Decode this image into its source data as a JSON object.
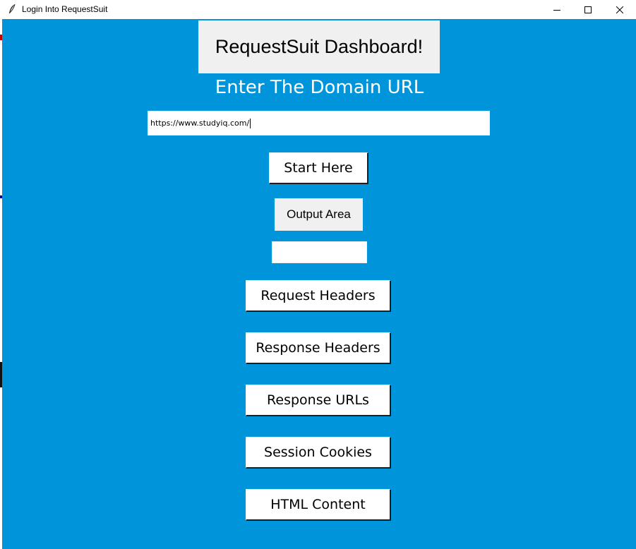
{
  "window": {
    "title": "Login Into RequestSuit",
    "controls": {
      "minimize": "minimize-icon",
      "maximize": "maximize-icon",
      "close": "close-icon"
    }
  },
  "header": {
    "title": "RequestSuit Dashboard!"
  },
  "form": {
    "prompt": "Enter The Domain URL",
    "url_value": "https://www.studyiq.com/",
    "start_label": "Start Here"
  },
  "output": {
    "label": "Output Area",
    "value": ""
  },
  "actions": [
    {
      "label": "Request Headers"
    },
    {
      "label": "Response Headers"
    },
    {
      "label": "Response URLs"
    },
    {
      "label": "Session Cookies"
    },
    {
      "label": "HTML Content"
    }
  ],
  "colors": {
    "background": "#0095da",
    "label_bg": "#f0f0f0",
    "button_bg": "#ffffff"
  }
}
